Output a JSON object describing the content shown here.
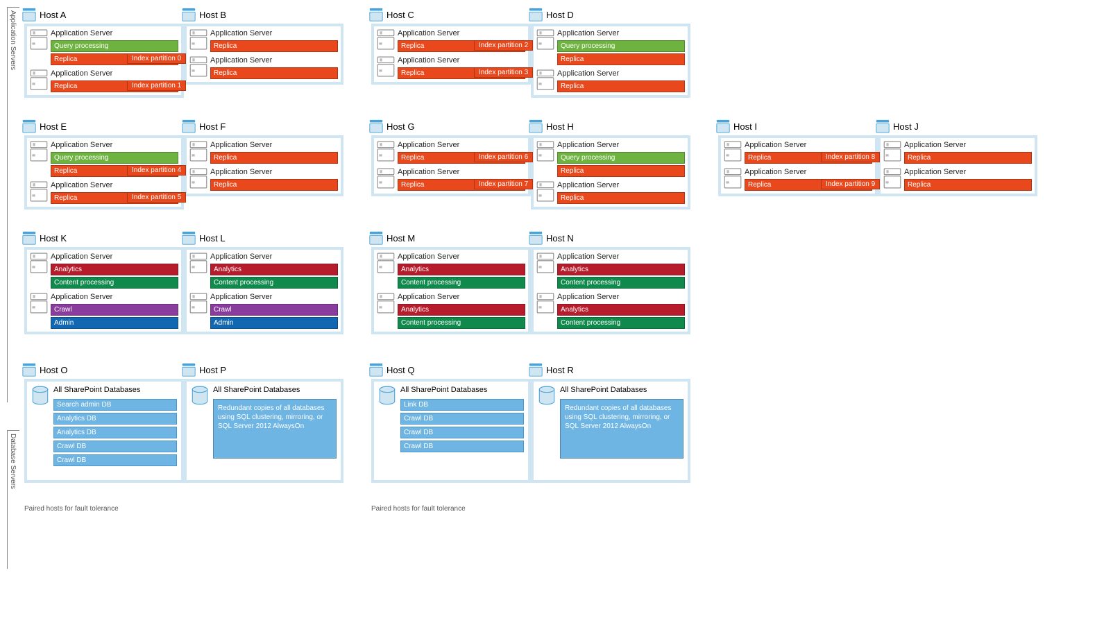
{
  "sections": {
    "appservers": "Application Servers",
    "dbservers": "Database Servers"
  },
  "labels": {
    "appserver": "Application Server",
    "replica": "Replica",
    "query": "Query processing",
    "analytics": "Analytics",
    "content": "Content processing",
    "crawl": "Crawl",
    "admin": "Admin",
    "allspdb": "All SharePoint Databases",
    "redundant": "Redundant copies of all databases using SQL clustering, mirroring, or SQL Server 2012 AlwaysOn",
    "paired": "Paired hosts for fault tolerance"
  },
  "hosts": {
    "A": "Host A",
    "B": "Host B",
    "C": "Host C",
    "D": "Host D",
    "E": "Host E",
    "F": "Host F",
    "G": "Host G",
    "H": "Host H",
    "I": "Host I",
    "J": "Host J",
    "K": "Host K",
    "L": "Host L",
    "M": "Host M",
    "N": "Host N",
    "O": "Host O",
    "P": "Host P",
    "Q": "Host Q",
    "R": "Host R"
  },
  "index": {
    "0": "Index partition 0",
    "1": "Index partition 1",
    "2": "Index partition 2",
    "3": "Index partition 3",
    "4": "Index partition 4",
    "5": "Index partition 5",
    "6": "Index partition 6",
    "7": "Index partition 7",
    "8": "Index partition 8",
    "9": "Index partition 9"
  },
  "dbitems": {
    "O": [
      "Search admin DB",
      "Analytics DB",
      "Analytics DB",
      "Crawl DB",
      "Crawl DB"
    ],
    "Q": [
      "Link DB",
      "Crawl DB",
      "Crawl DB",
      "Crawl DB"
    ]
  }
}
